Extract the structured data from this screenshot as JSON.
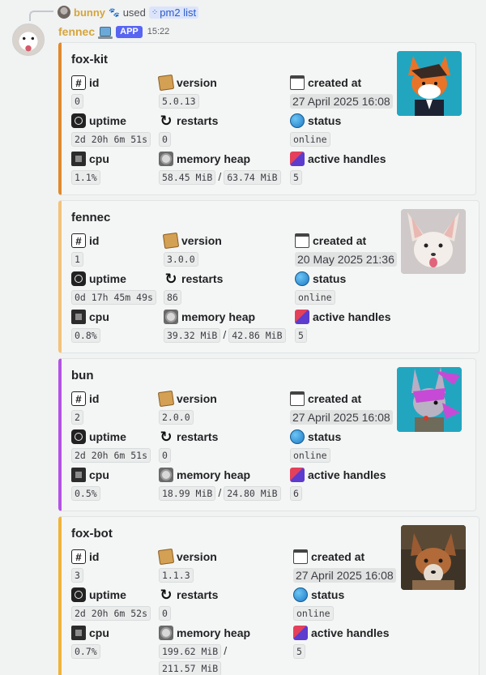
{
  "reply": {
    "user": "bunny",
    "verb": "used",
    "command": "pm2 list"
  },
  "message": {
    "author": "fennec",
    "badge": "APP",
    "time": "15:22"
  },
  "labels": {
    "id": "id",
    "version": "version",
    "created_at": "created at",
    "uptime": "uptime",
    "restarts": "restarts",
    "status": "status",
    "cpu": "cpu",
    "memory_heap": "memory heap",
    "active_handles": "active handles"
  },
  "colors": {
    "accent_orange": "#e08a2b",
    "accent_light_orange": "#f3c27a",
    "accent_purple": "#b453e6",
    "accent_yellow": "#f0b438",
    "username": "#d6a53b",
    "app_badge": "#5865f2"
  },
  "processes": [
    {
      "name": "fox-kit",
      "id": "0",
      "version": "5.0.13",
      "created_at": "27 April 2025 16:08",
      "uptime": "2d 20h 6m 51s",
      "restarts": "0",
      "status": "online",
      "cpu": "1.1%",
      "heap_used": "58.45 MiB",
      "heap_total": "63.74 MiB",
      "active_handles": "5"
    },
    {
      "name": "fennec",
      "id": "1",
      "version": "3.0.0",
      "created_at": "20 May 2025 21:36",
      "uptime": "0d 17h 45m 49s",
      "restarts": "86",
      "status": "online",
      "cpu": "0.8%",
      "heap_used": "39.32 MiB",
      "heap_total": "42.86 MiB",
      "active_handles": "5"
    },
    {
      "name": "bun",
      "id": "2",
      "version": "2.0.0",
      "created_at": "27 April 2025 16:08",
      "uptime": "2d 20h 6m 51s",
      "restarts": "0",
      "status": "online",
      "cpu": "0.5%",
      "heap_used": "18.99 MiB",
      "heap_total": "24.80 MiB",
      "active_handles": "6"
    },
    {
      "name": "fox-bot",
      "id": "3",
      "version": "1.1.3",
      "created_at": "27 April 2025 16:08",
      "uptime": "2d 20h 6m 52s",
      "restarts": "0",
      "status": "online",
      "cpu": "0.7%",
      "heap_used": "199.62 MiB",
      "heap_total": "211.57 MiB",
      "active_handles": "5"
    }
  ]
}
